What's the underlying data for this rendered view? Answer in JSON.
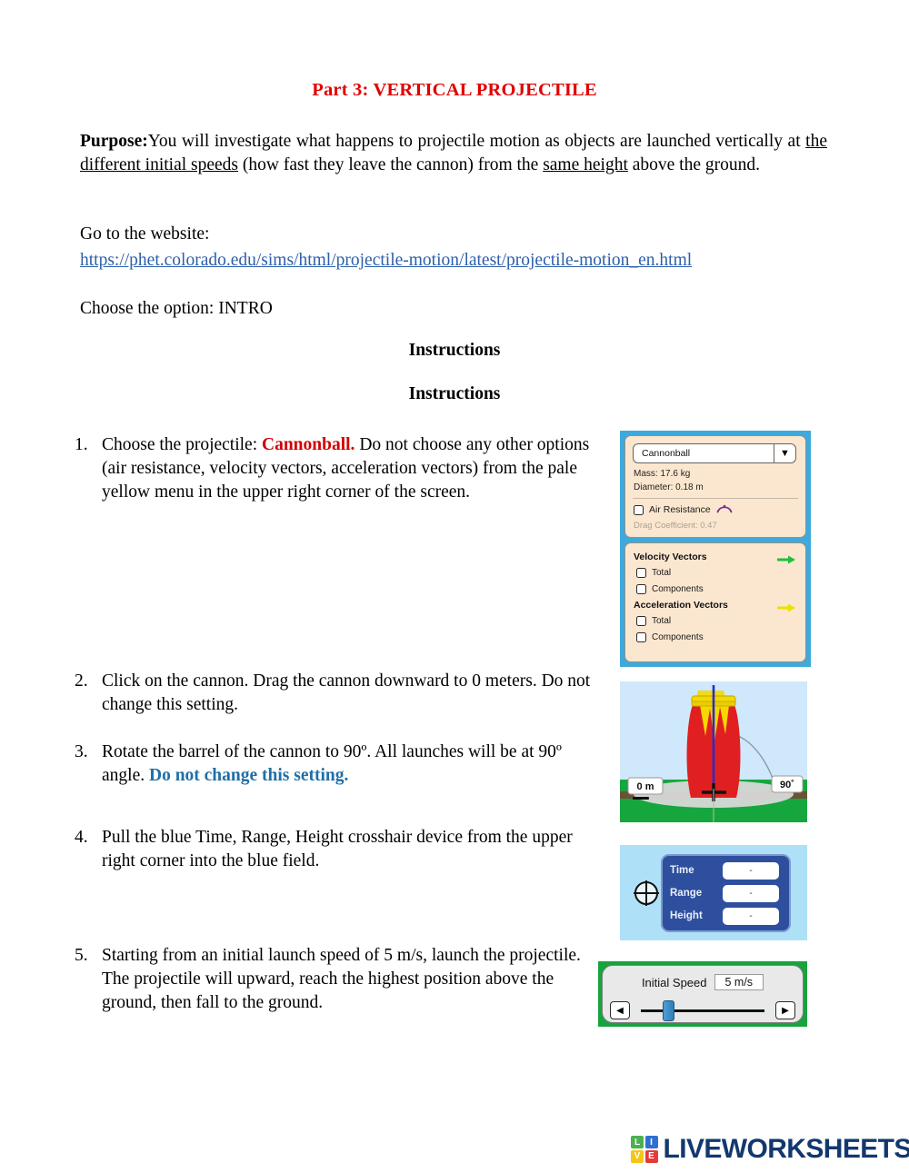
{
  "document": {
    "title": "Part 3:  VERTICAL PROJECTILE",
    "purpose_label": "Purpose:",
    "purpose_part1": "You will investigate what happens to projectile motion as objects are launched vertically at ",
    "purpose_underline1": "the different initial speeds",
    "purpose_part2": " (how fast they leave the cannon) from the ",
    "purpose_underline2": "same height",
    "purpose_part3": " above the ground.",
    "goto_line": "Go to the website:",
    "url": "https://phet.colorado.edu/sims/html/projectile-motion/latest/projectile-motion_en.html",
    "choose_option": "Choose the option:  INTRO",
    "instructions_heading_1": "Instructions",
    "instructions_heading_2": "Instructions"
  },
  "items": [
    {
      "number": "1.",
      "text_before": "Choose the projectile: ",
      "highlight": "Cannonball.",
      "text_after": "   Do not choose any other options (air resistance, velocity vectors, acceleration vectors) from the pale yellow menu in the upper right corner of the screen."
    },
    {
      "number": "2.",
      "text": "Click on the cannon.  Drag the cannon downward to 0 meters.  Do not change this setting."
    },
    {
      "number": "3.",
      "text_before": "Rotate the barrel of the cannon to 90º.  All launches will be at 90º angle. ",
      "highlight": "Do not change this setting."
    },
    {
      "number": "4.",
      "text": "Pull the blue Time, Range, Height crosshair device from the upper right corner into the blue field."
    },
    {
      "number": "5.",
      "text": "Starting from an initial launch speed of 5 m/s, launch the projectile.  The projectile will upward, reach the highest position above the ground, then fall to the ground."
    }
  ],
  "control_panel": {
    "projectile_select": "Cannonball",
    "mass": "Mass: 17.6 kg",
    "diameter": "Diameter: 0.18 m",
    "air_resistance": "Air Resistance",
    "drag_coefficient": "Drag Coefficient: 0.47",
    "velocity_vectors": "Velocity Vectors",
    "velocity_total": "Total",
    "velocity_components": "Components",
    "acceleration_vectors": "Acceleration Vectors",
    "acceleration_total": "Total",
    "acceleration_components": "Components",
    "velocity_arrow_color": "#1fbf3f",
    "acceleration_arrow_color": "#ebe000",
    "panel_bg": "#fbe7cf",
    "border_color": "#3fa9dc"
  },
  "cannon_figure": {
    "ground_label": "0 m",
    "angle_label": "90˚",
    "sky_color": "#cfe8fb",
    "grass_color": "#15a63e",
    "cannon_color": "#e02020",
    "flame_color": "#f5d800"
  },
  "measuring_tool": {
    "rows": [
      {
        "label": "Time",
        "value": "-"
      },
      {
        "label": "Range",
        "value": "-"
      },
      {
        "label": "Height",
        "value": "-"
      }
    ],
    "panel_color": "#2e4f9e",
    "field_bg": "#aee0f7"
  },
  "speed_control": {
    "title": "Initial Speed",
    "value": "5 m/s",
    "decrement_icon": "◀",
    "increment_icon": "▶",
    "frame_color": "#18a33e"
  },
  "footer": {
    "tiles": [
      "L",
      "I",
      "V",
      "E"
    ],
    "wordmark": "LIVEWORKSHEETS"
  }
}
